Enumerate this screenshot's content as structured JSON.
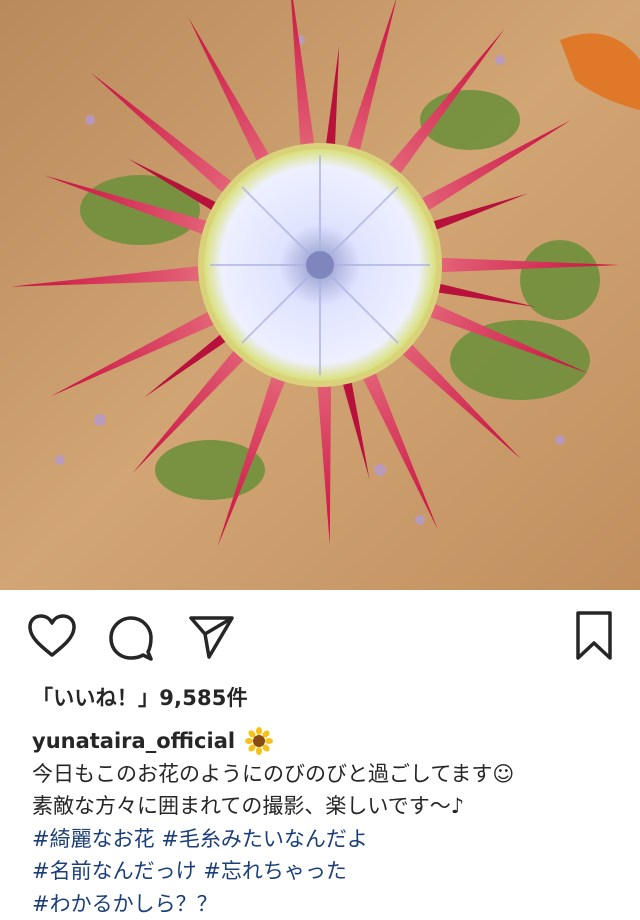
{
  "post": {
    "image_alt": "king protea flower photo",
    "likes_text": "「いいね！」9,585件",
    "username": "yunataira_official",
    "username_emoji": "sunflower-icon",
    "caption_lines": [
      "今日もこのお花のようにのびのびと過ごしてます☺",
      "素敵な方々に囲まれての撮影、楽しいです〜♪"
    ],
    "hashtags": [
      "#綺麗なお花",
      "#毛糸みたいなんだよ",
      "#名前なんだっけ",
      "#忘れちゃった",
      "#わかるかしら？？"
    ]
  },
  "actions": {
    "like": "heart-icon",
    "comment": "comment-icon",
    "share": "share-icon",
    "save": "bookmark-icon"
  },
  "colors": {
    "hashtag": "#1c3f7a",
    "text": "#262626",
    "petal_red": "#d2234d",
    "petal_base": "#e8c98a",
    "center": "#e9ecff"
  }
}
